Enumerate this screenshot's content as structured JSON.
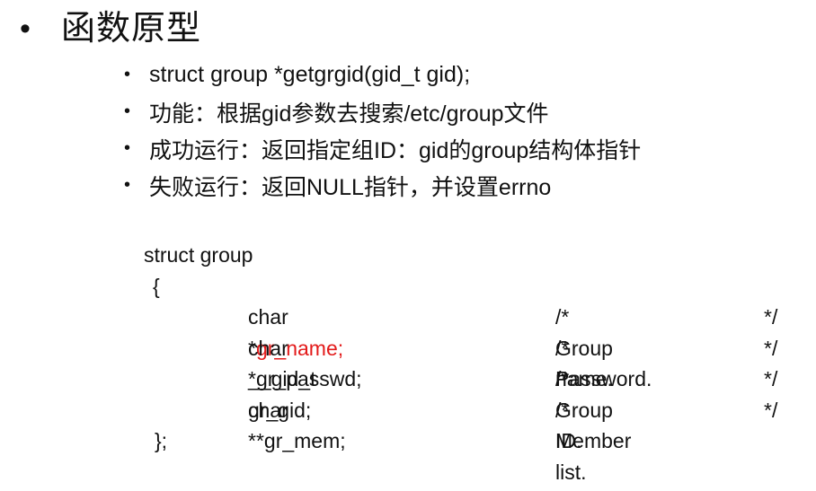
{
  "title": {
    "bullet": "•",
    "text": "函数原型"
  },
  "bullets": [
    {
      "dot": "•",
      "text": "struct group *getgrgid(gid_t gid);"
    },
    {
      "dot": "•",
      "text": "功能：根据gid参数去搜索/etc/group文件"
    },
    {
      "dot": "•",
      "text": "成功运行：返回指定组ID：gid的group结构体指针"
    },
    {
      "dot": "•",
      "text": "失败运行：返回NULL指针，并设置errno"
    }
  ],
  "code": {
    "header": "struct group",
    "open_brace": "{",
    "fields": [
      {
        "type": "char *",
        "name": "gr_name;",
        "comment": "/* Group name.",
        "end": "*/"
      },
      {
        "type": "char *",
        "name": "gr_passwd;",
        "comment": "/* Password.",
        "end": "*/"
      },
      {
        "type": "__gid_t ",
        "name": "gr_gid;",
        "comment": "/* Group ID.",
        "end": "*/"
      },
      {
        "type": "char **",
        "name": "gr_mem;",
        "comment": "/* Member list.",
        "end": "*/"
      }
    ],
    "close_brace": "};"
  },
  "colors": {
    "highlight": "#e31b1b",
    "text": "#111111"
  }
}
